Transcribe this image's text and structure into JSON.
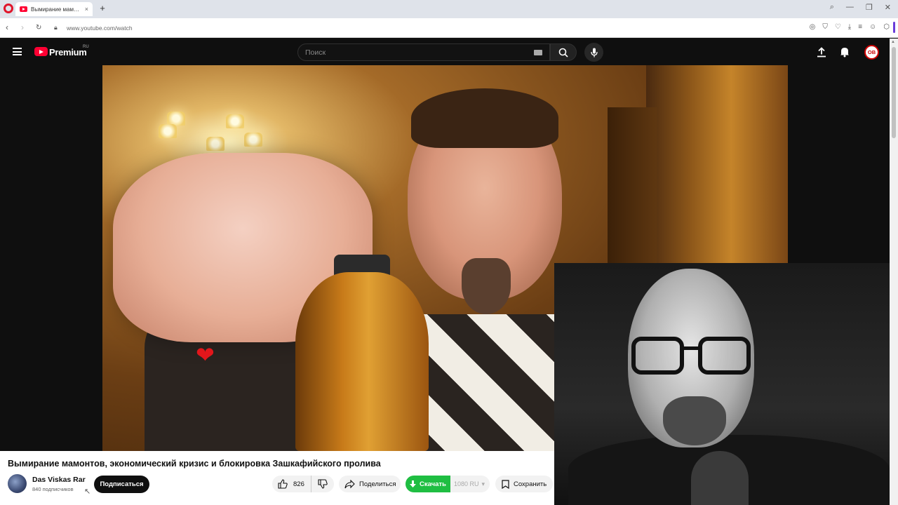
{
  "browser": {
    "tab_title": "Вымирание мамонтов, э",
    "tab_close": "×",
    "new_tab": "+",
    "url": "www.youtube.com/watch",
    "icons": [
      "opera-logo-icon",
      "back-icon",
      "forward-icon",
      "reload-icon",
      "lock-icon",
      "search-icon",
      "minimize-icon",
      "maximize-icon",
      "close-icon"
    ]
  },
  "youtube": {
    "brand": "Premium",
    "region": "RU",
    "search_placeholder": "Поиск",
    "account_initials": "ОВ"
  },
  "video": {
    "title": "Вымирание мамонтов, экономический кризис и блокировка Зашкафийского пролива",
    "channel_name": "Das Viskas Rar",
    "subscribers": "840 подписчиков",
    "subscribe_label": "Подписаться",
    "likes": "826",
    "share_label": "Поделиться",
    "download_label": "Скачать",
    "download_quality": "1080 RU",
    "save_label": "Сохранить"
  },
  "colors": {
    "youtube_red": "#ff0033",
    "download_green": "#1fbe42",
    "browser_accent": "#6a3cd9"
  }
}
